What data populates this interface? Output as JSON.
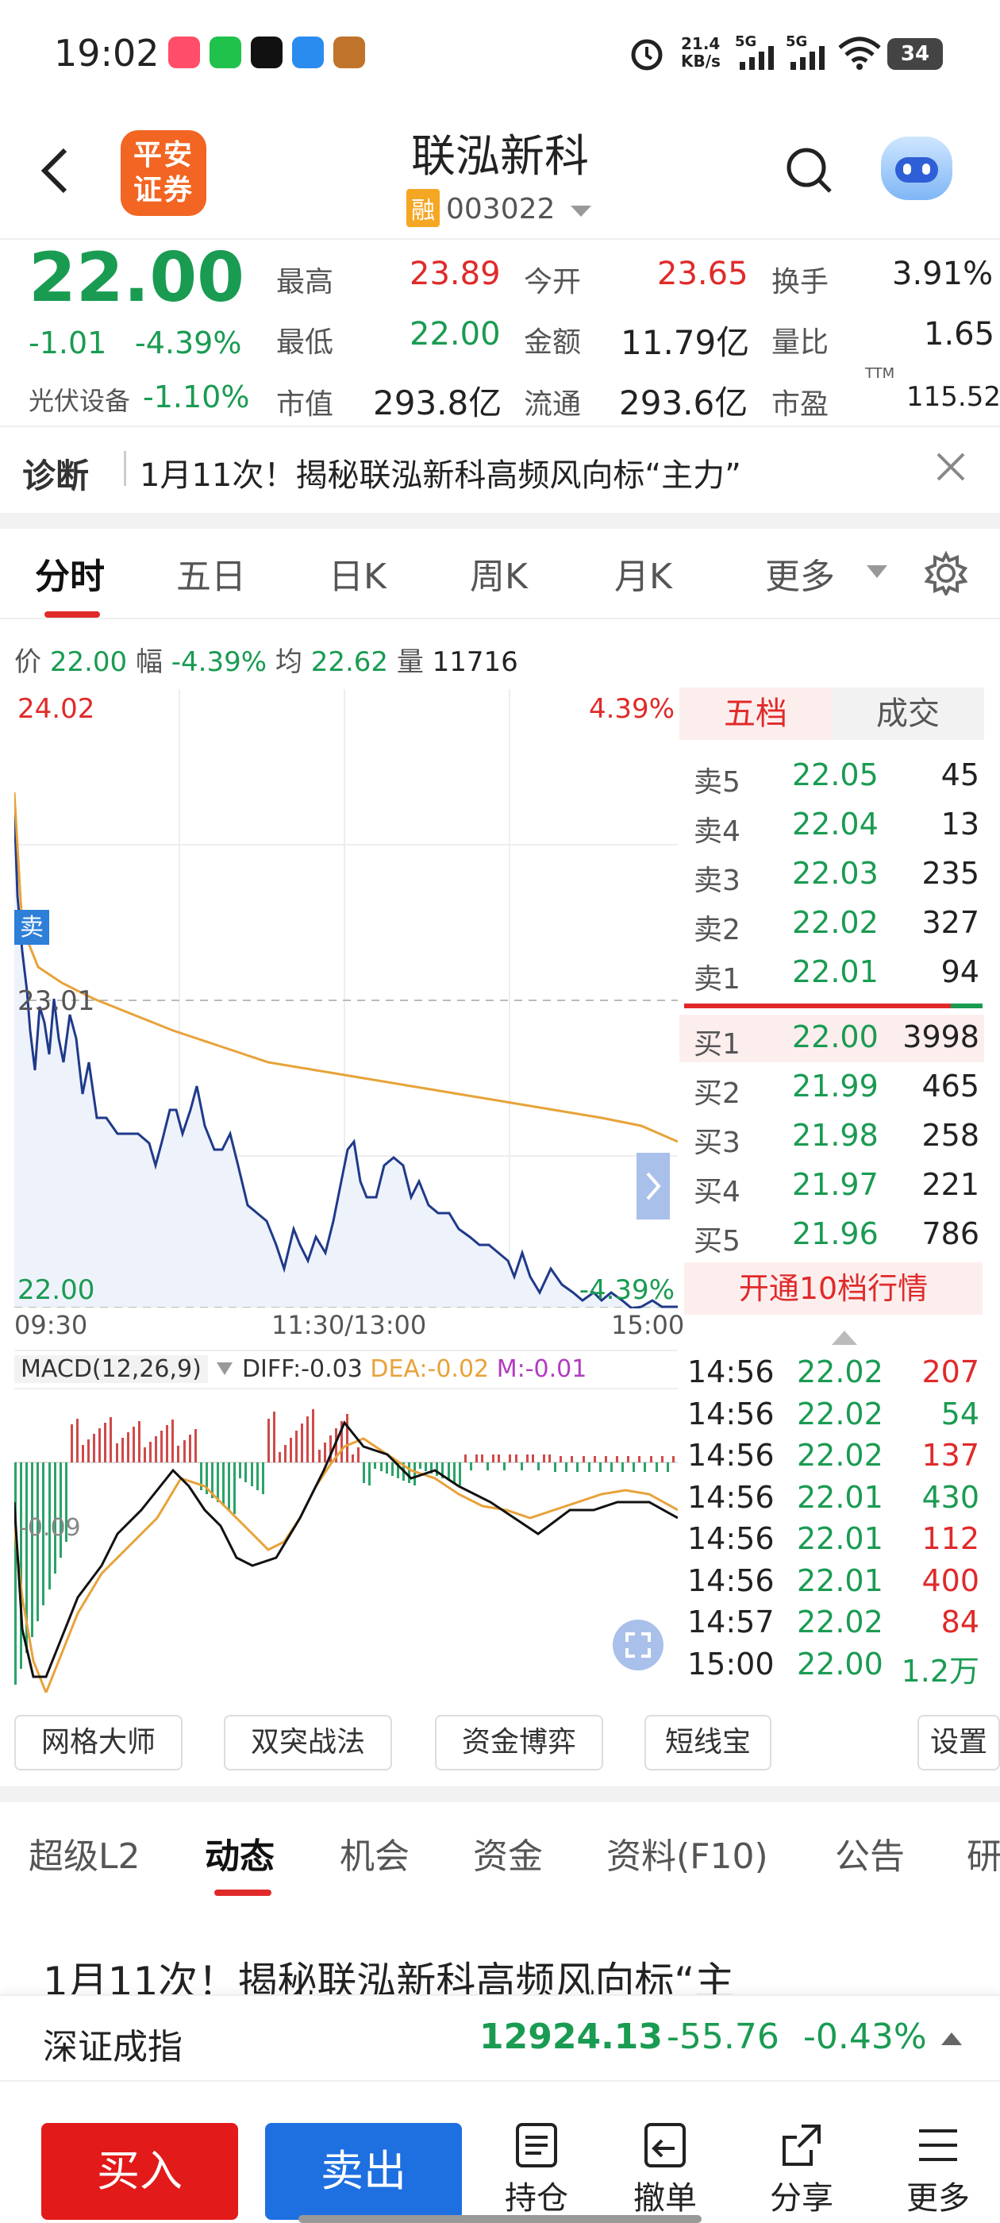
{
  "status_bar": {
    "time": "19:02",
    "net_speed": "21.4\nKB/s",
    "sig1": "5G",
    "sig2": "5G",
    "battery": "34"
  },
  "header": {
    "logo_text": "平安\n证券",
    "name": "联泓新科",
    "rong": "融",
    "code": "003022"
  },
  "quote": {
    "price": "22.00",
    "change": "-1.01",
    "change_pct": "-4.39%",
    "sector": "光伏设备",
    "sector_pct": "-1.10%",
    "high_label": "最高",
    "high": "23.89",
    "open_label": "今开",
    "open": "23.65",
    "turnover_label": "换手",
    "turnover": "3.91%",
    "low_label": "最低",
    "low": "22.00",
    "amount_label": "金额",
    "amount": "11.79亿",
    "vol_ratio_label": "量比",
    "vol_ratio": "1.65",
    "mktcap_label": "市值",
    "mktcap": "293.8亿",
    "float_label": "流通",
    "float": "293.6亿",
    "pe_label": "市盈",
    "pe_sup": "TTM",
    "pe": "115.52"
  },
  "diagnosis": {
    "label": "诊断",
    "text": "1月11次！揭秘联泓新科高频风向标“主力”"
  },
  "chart_tabs": [
    "分时",
    "五日",
    "日K",
    "周K",
    "月K",
    "更多"
  ],
  "info_line": {
    "price_label": "价",
    "price": "22.00",
    "range_label": "幅",
    "range": "-4.39%",
    "avg_label": "均",
    "avg": "22.62",
    "vol_label": "量",
    "vol": "11716"
  },
  "chart": {
    "y_top": "24.02",
    "y_top_pct": "4.39%",
    "y_mid": "23.01",
    "y_bot": "22.00",
    "y_bot_pct": "-4.39%",
    "sell_marker": "卖",
    "x_labels": [
      "09:30",
      "11:30/13:00",
      "15:00"
    ]
  },
  "macd": {
    "title": "MACD(12,26,9)",
    "diff": "DIFF:-0.03",
    "dea": "DEA:-0.02",
    "m": "M:-0.01",
    "axis_low": "-0.09"
  },
  "order_book": {
    "tab_five": "五档",
    "tab_trades": "成交",
    "asks": [
      {
        "label": "卖5",
        "price": "22.05",
        "vol": "45"
      },
      {
        "label": "卖4",
        "price": "22.04",
        "vol": "13"
      },
      {
        "label": "卖3",
        "price": "22.03",
        "vol": "235"
      },
      {
        "label": "卖2",
        "price": "22.02",
        "vol": "327"
      },
      {
        "label": "卖1",
        "price": "22.01",
        "vol": "94"
      }
    ],
    "bids": [
      {
        "label": "买1",
        "price": "22.00",
        "vol": "3998"
      },
      {
        "label": "买2",
        "price": "21.99",
        "vol": "465"
      },
      {
        "label": "买3",
        "price": "21.98",
        "vol": "258"
      },
      {
        "label": "买4",
        "price": "21.97",
        "vol": "221"
      },
      {
        "label": "买5",
        "price": "21.96",
        "vol": "786"
      }
    ],
    "upgrade": "开通10档行情",
    "trades": [
      {
        "time": "14:56",
        "price": "22.02",
        "vol": "207"
      },
      {
        "time": "14:56",
        "price": "22.02",
        "vol": "54"
      },
      {
        "time": "14:56",
        "price": "22.02",
        "vol": "137"
      },
      {
        "time": "14:56",
        "price": "22.01",
        "vol": "430"
      },
      {
        "time": "14:56",
        "price": "22.01",
        "vol": "112"
      },
      {
        "time": "14:56",
        "price": "22.01",
        "vol": "400"
      },
      {
        "time": "14:57",
        "price": "22.02",
        "vol": "84"
      },
      {
        "time": "15:00",
        "price": "22.00",
        "vol": "1.2万"
      }
    ]
  },
  "tools": [
    "网格大师",
    "双突战法",
    "资金博弈",
    "短线宝",
    "设置"
  ],
  "section_tabs": [
    "超级L2",
    "动态",
    "机会",
    "资金",
    "资料(F10)",
    "公告",
    "研"
  ],
  "news_title": "1月11次！揭秘联泓新科高频风向标“主",
  "index_bar": {
    "name": "深证成指",
    "value": "12924.13",
    "change": "-55.76",
    "pct": "-0.43%"
  },
  "bottom": {
    "buy": "买入",
    "sell": "卖出",
    "hold": "持仓",
    "cancel": "撤单",
    "share": "分享",
    "more": "更多"
  }
}
